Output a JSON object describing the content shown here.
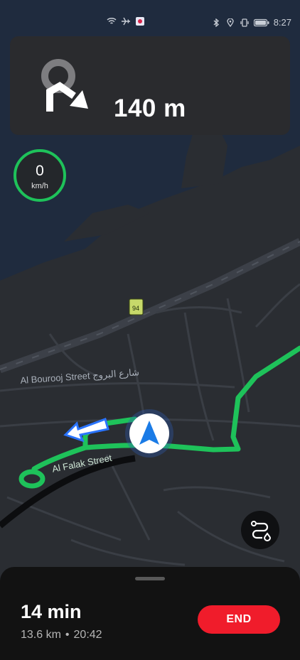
{
  "status_bar": {
    "time": "8:27",
    "left_icons": [
      "wifi-icon",
      "airplane-mode-icon",
      "app-notification-icon"
    ],
    "right_icons": [
      "bluetooth-icon",
      "location-icon",
      "vibrate-icon",
      "battery-icon"
    ]
  },
  "instruction": {
    "distance": "140 m",
    "maneuver_icon": "roundabout-turn-right-icon"
  },
  "speed": {
    "value": "0",
    "unit": "km/h",
    "ring_color": "#1ec25a"
  },
  "map": {
    "streets": [
      "Al Bourooj Street شارع البروج",
      "Al Falak Street"
    ],
    "road_sign": "94",
    "route_color": "#1ec25a",
    "water_color": "#1f2b3e",
    "land_color": "#2a2d32"
  },
  "route_button_icon": "route-options-icon",
  "trip": {
    "duration": "14 min",
    "distance": "13.6 km",
    "separator": "•",
    "arrival": "20:42"
  },
  "end_button_label": "END",
  "end_button_color": "#f01c2b"
}
